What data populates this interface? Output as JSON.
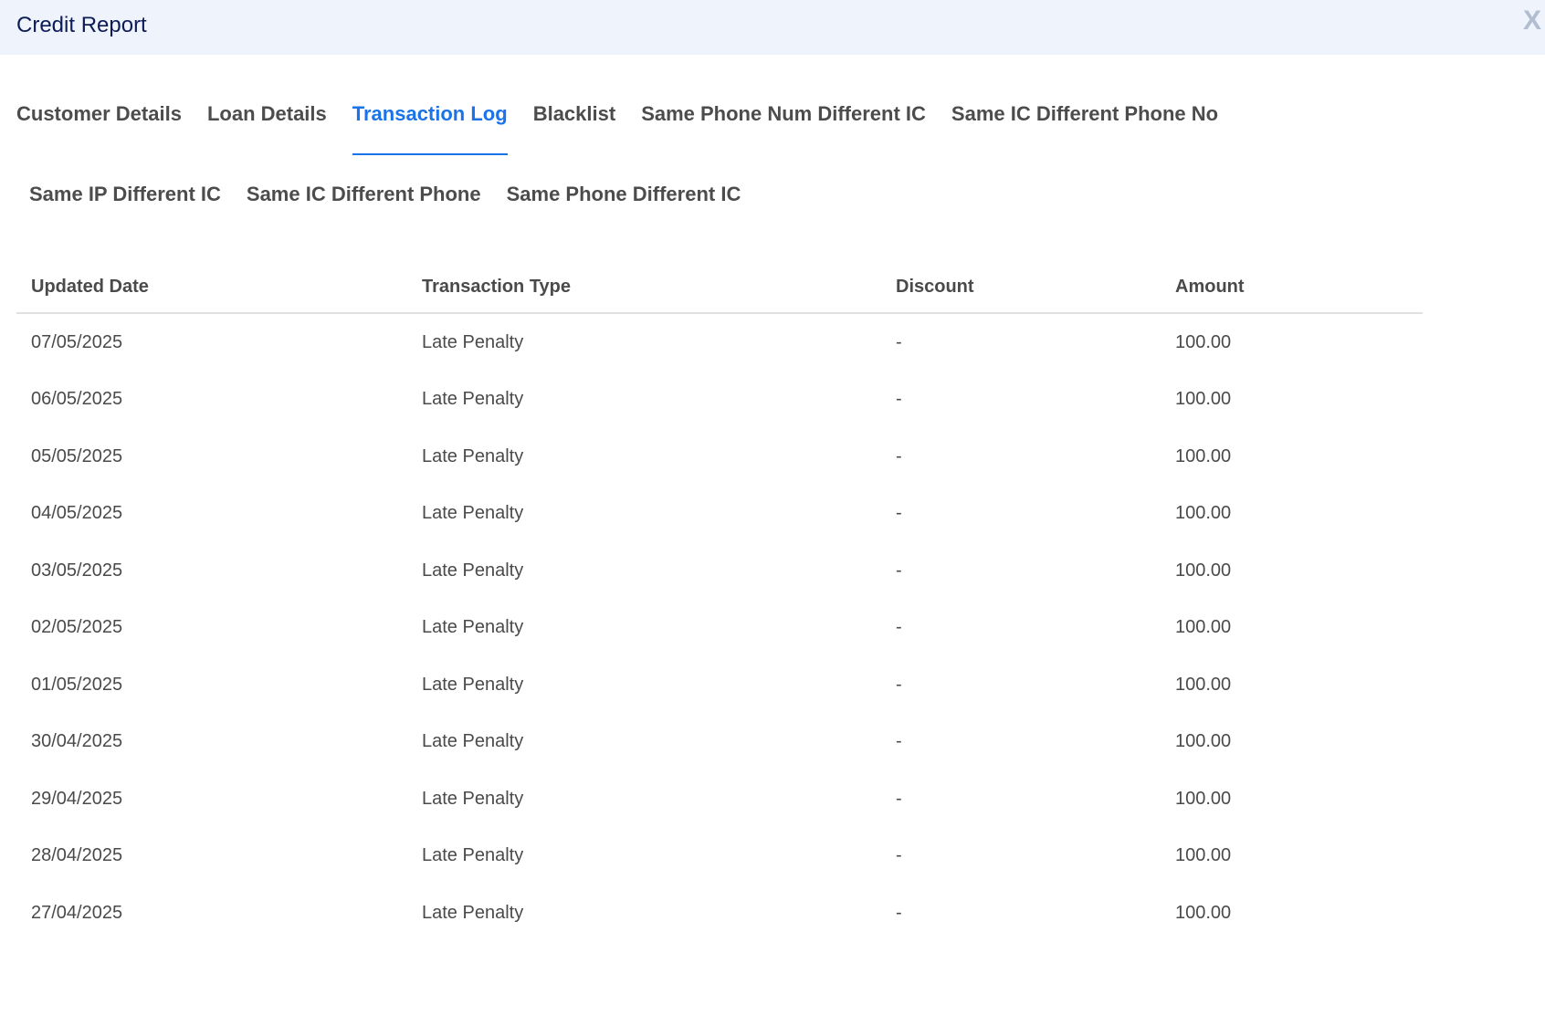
{
  "header": {
    "title": "Credit Report",
    "close_label": "X"
  },
  "tabs": {
    "row1": [
      {
        "label": "Customer Details"
      },
      {
        "label": "Loan Details"
      },
      {
        "label": "Transaction Log",
        "active": true
      },
      {
        "label": "Blacklist"
      },
      {
        "label": "Same Phone Num Different IC"
      },
      {
        "label": "Same IC Different Phone No"
      }
    ],
    "row2": [
      {
        "label": "Same IP Different IC"
      },
      {
        "label": "Same IC Different Phone"
      },
      {
        "label": "Same Phone Different IC"
      }
    ]
  },
  "table": {
    "columns": [
      "Updated Date",
      "Transaction Type",
      "Discount",
      "Amount"
    ],
    "rows": [
      [
        "07/05/2025",
        "Late Penalty",
        "-",
        "100.00"
      ],
      [
        "06/05/2025",
        "Late Penalty",
        "-",
        "100.00"
      ],
      [
        "05/05/2025",
        "Late Penalty",
        "-",
        "100.00"
      ],
      [
        "04/05/2025",
        "Late Penalty",
        "-",
        "100.00"
      ],
      [
        "03/05/2025",
        "Late Penalty",
        "-",
        "100.00"
      ],
      [
        "02/05/2025",
        "Late Penalty",
        "-",
        "100.00"
      ],
      [
        "01/05/2025",
        "Late Penalty",
        "-",
        "100.00"
      ],
      [
        "30/04/2025",
        "Late Penalty",
        "-",
        "100.00"
      ],
      [
        "29/04/2025",
        "Late Penalty",
        "-",
        "100.00"
      ],
      [
        "28/04/2025",
        "Late Penalty",
        "-",
        "100.00"
      ],
      [
        "27/04/2025",
        "Late Penalty",
        "-",
        "100.00"
      ]
    ]
  },
  "colors": {
    "accent": "#1a73e8",
    "header_bg": "#eef3fc",
    "title": "#0d1b57"
  }
}
